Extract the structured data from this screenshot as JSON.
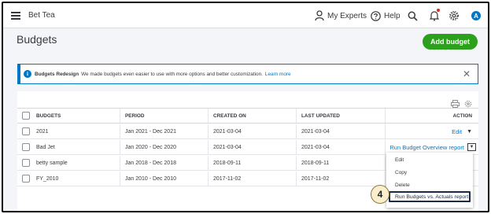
{
  "topbar": {
    "company": "Bet Tea",
    "experts_label": "My Experts",
    "help_label": "Help",
    "avatar_initial": "A"
  },
  "page": {
    "title": "Budgets",
    "add_button": "Add budget"
  },
  "banner": {
    "title": "Budgets Redesign",
    "message": "We made budgets even easier to use with more options and better customization.",
    "link": "Learn more",
    "close": "✕"
  },
  "table": {
    "headers": {
      "budgets": "BUDGETS",
      "period": "PERIOD",
      "created_on": "CREATED ON",
      "last_updated": "LAST UPDATED",
      "action": "ACTION"
    },
    "rows": [
      {
        "name": "2021",
        "period": "Jan 2021 - Dec 2021",
        "created": "2021-03-04",
        "updated": "2021-03-04",
        "action": "Edit"
      },
      {
        "name": "Bad Jet",
        "period": "Jan 2020 - Dec 2020",
        "created": "2021-03-04",
        "updated": "2021-03-04",
        "action": "Run Budget Overview report"
      },
      {
        "name": "betty sample",
        "period": "Jan 2018 - Dec 2018",
        "created": "2018-09-11",
        "updated": "2018-09-11",
        "action": ""
      },
      {
        "name": "FY_2010",
        "period": "Jan 2010 - Dec 2010",
        "created": "2017-11-02",
        "updated": "2017-11-02",
        "action": ""
      }
    ]
  },
  "menu": {
    "items": [
      "Edit",
      "Copy",
      "Delete",
      "Run Budgets vs. Actuals report"
    ]
  },
  "callout": {
    "step": "4"
  },
  "colors": {
    "brand_green": "#2ca01c",
    "link_blue": "#0077c5",
    "highlight_navy": "#1b2a4a"
  }
}
